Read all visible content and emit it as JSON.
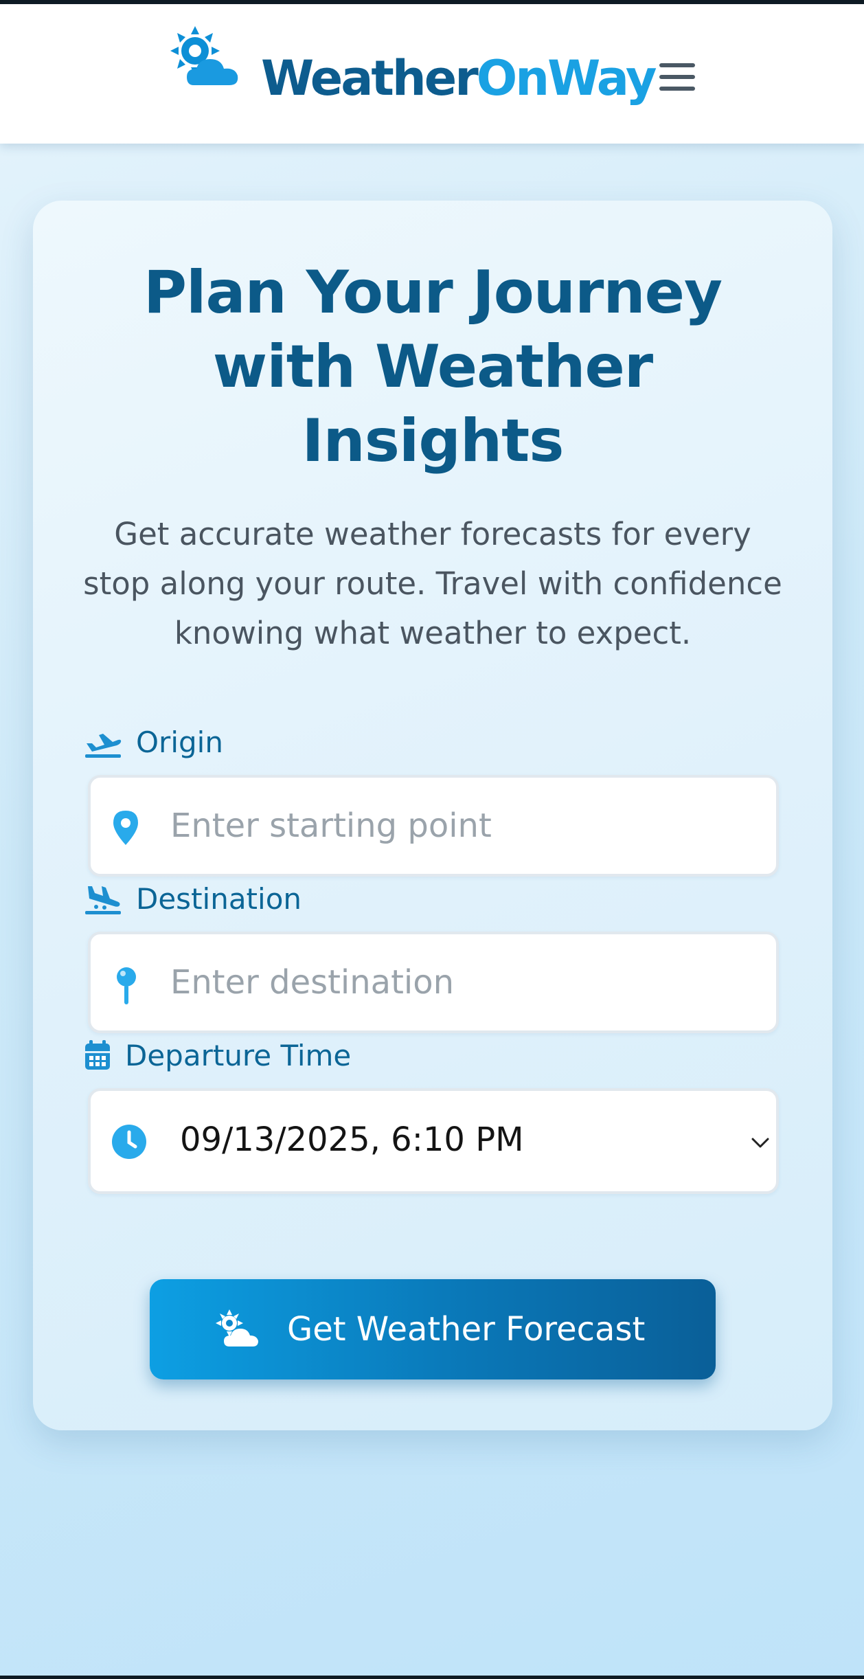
{
  "colors": {
    "brand_dark": "#0d5c8e",
    "brand_light": "#1aa1e3",
    "label": "#0b6596",
    "icon_accent": "#29aaeb",
    "button_start": "#0d9fe3",
    "button_end": "#0a5f98"
  },
  "header": {
    "logo_part1": "Weather",
    "logo_part2": "OnWay",
    "logo_icon": "sun-cloud-icon",
    "menu_icon": "hamburger-menu-icon"
  },
  "hero": {
    "title": "Plan Your Journey with Weather Insights",
    "subtitle": "Get accurate weather forecasts for every stop along your route. Travel with confidence knowing what weather to expect."
  },
  "form": {
    "origin": {
      "label": "Origin",
      "label_icon": "plane-departure-icon",
      "input_icon": "map-pin-icon",
      "placeholder": "Enter starting point",
      "value": ""
    },
    "destination": {
      "label": "Destination",
      "label_icon": "plane-arrival-icon",
      "input_icon": "pushpin-icon",
      "placeholder": "Enter destination",
      "value": ""
    },
    "departure": {
      "label": "Departure Time",
      "label_icon": "calendar-icon",
      "input_icon": "clock-icon",
      "value": "09/13/2025, 6:10 PM",
      "dropdown_icon": "chevron-down-icon"
    },
    "submit": {
      "label": "Get Weather Forecast",
      "icon": "sun-cloud-icon"
    }
  }
}
